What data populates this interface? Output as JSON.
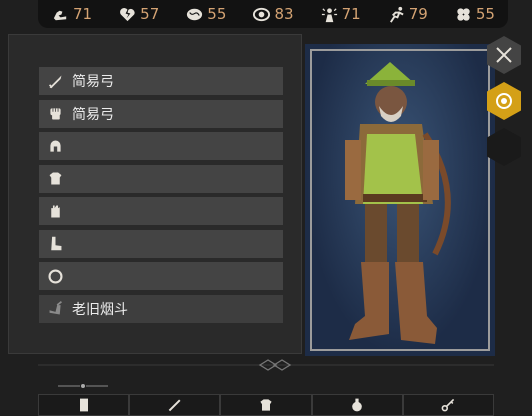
{
  "stats": [
    {
      "icon": "strength-icon",
      "value": "71"
    },
    {
      "icon": "broken-heart-icon",
      "value": "57"
    },
    {
      "icon": "brain-icon",
      "value": "55"
    },
    {
      "icon": "eye-icon",
      "value": "83"
    },
    {
      "icon": "spark-person-icon",
      "value": "71"
    },
    {
      "icon": "runner-icon",
      "value": "79"
    },
    {
      "icon": "clover-icon",
      "value": "55"
    }
  ],
  "equipment": [
    {
      "slot": "weapon",
      "icon": "sword-icon",
      "label": "简易弓"
    },
    {
      "slot": "offhand",
      "icon": "fist-icon",
      "label": "简易弓"
    },
    {
      "slot": "head",
      "icon": "helmet-icon",
      "label": ""
    },
    {
      "slot": "body",
      "icon": "armor-icon",
      "label": ""
    },
    {
      "slot": "hands",
      "icon": "glove-icon",
      "label": ""
    },
    {
      "slot": "feet",
      "icon": "boot-icon",
      "label": ""
    },
    {
      "slot": "ring",
      "icon": "ring-icon",
      "label": ""
    },
    {
      "slot": "trinket",
      "icon": "pipe-icon",
      "label": "老旧烟斗"
    }
  ],
  "side_buttons": [
    {
      "icon": "crossed-arrows-icon",
      "state": "normal"
    },
    {
      "icon": "target-icon",
      "state": "active"
    },
    {
      "icon": "empty-hex-icon",
      "state": "empty"
    }
  ],
  "tabs": [
    {
      "icon": "armor-stand-icon"
    },
    {
      "icon": "sword-icon"
    },
    {
      "icon": "armor-icon"
    },
    {
      "icon": "potion-icon"
    },
    {
      "icon": "key-icon"
    }
  ],
  "colors": {
    "accent": "#d4a017",
    "stat_text": "#d4a373",
    "portrait_bg": "#1c2b45"
  }
}
